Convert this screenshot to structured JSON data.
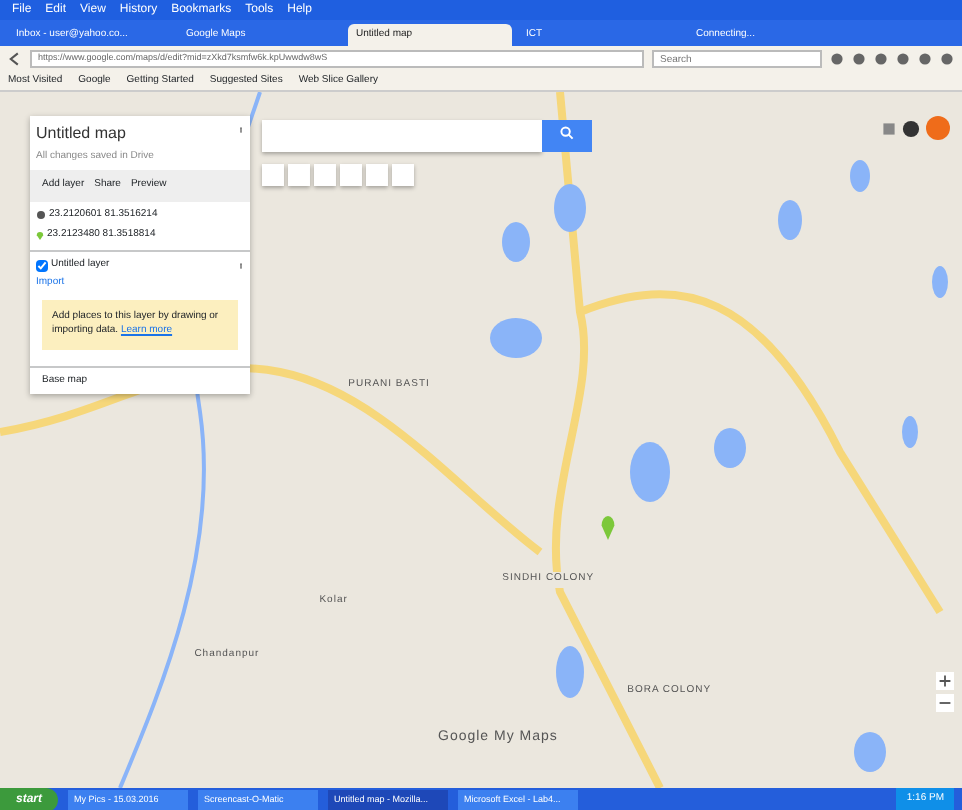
{
  "menu": [
    "File",
    "Edit",
    "View",
    "History",
    "Bookmarks",
    "Tools",
    "Help"
  ],
  "tabs": [
    {
      "label": "Inbox - user@yahoo.co...",
      "selected": false
    },
    {
      "label": "Google Maps",
      "selected": false
    },
    {
      "label": "Untitled map",
      "selected": true
    },
    {
      "label": "ICT",
      "selected": false
    },
    {
      "label": "Connecting...",
      "selected": false
    }
  ],
  "address_bar": {
    "url": "https://www.google.com/maps/d/edit?mid=zXkd7ksmfw6k.kpUwwdw8wS",
    "search_placeholder": "Search"
  },
  "bookmarks": [
    "Most Visited",
    "Google",
    "Getting Started",
    "Suggested Sites",
    "Web Slice Gallery"
  ],
  "map_panel": {
    "title": "Untitled map",
    "subtitle": "All changes saved in Drive",
    "actions": [
      "Add layer",
      "Share",
      "Preview"
    ],
    "directions": {
      "route": "23.2120601 81.3516214",
      "point": "23.2123480 81.3518814"
    },
    "layer": {
      "name": "Untitled layer",
      "checked": true,
      "import": "Import",
      "hint": "Add places to this layer by drawing or importing data.",
      "hint_link": "Learn more"
    },
    "base_map": "Base map"
  },
  "map_labels": [
    {
      "text": "PURANI BASTI"
    },
    {
      "text": "Kolar"
    },
    {
      "text": "Chandanpur"
    },
    {
      "text": "SINDHI COLONY"
    },
    {
      "text": "BORA COLONY"
    }
  ],
  "attribution": "Google My Maps",
  "taskbar": {
    "start": "start",
    "items": [
      {
        "label": "My Pics - 15.03.2016",
        "selected": false
      },
      {
        "label": "Screencast-O-Matic",
        "selected": false
      },
      {
        "label": "Untitled map - Mozilla...",
        "selected": true
      },
      {
        "label": "Microsoft Excel - Lab4...",
        "selected": false
      }
    ],
    "clock": "1:16 PM"
  }
}
